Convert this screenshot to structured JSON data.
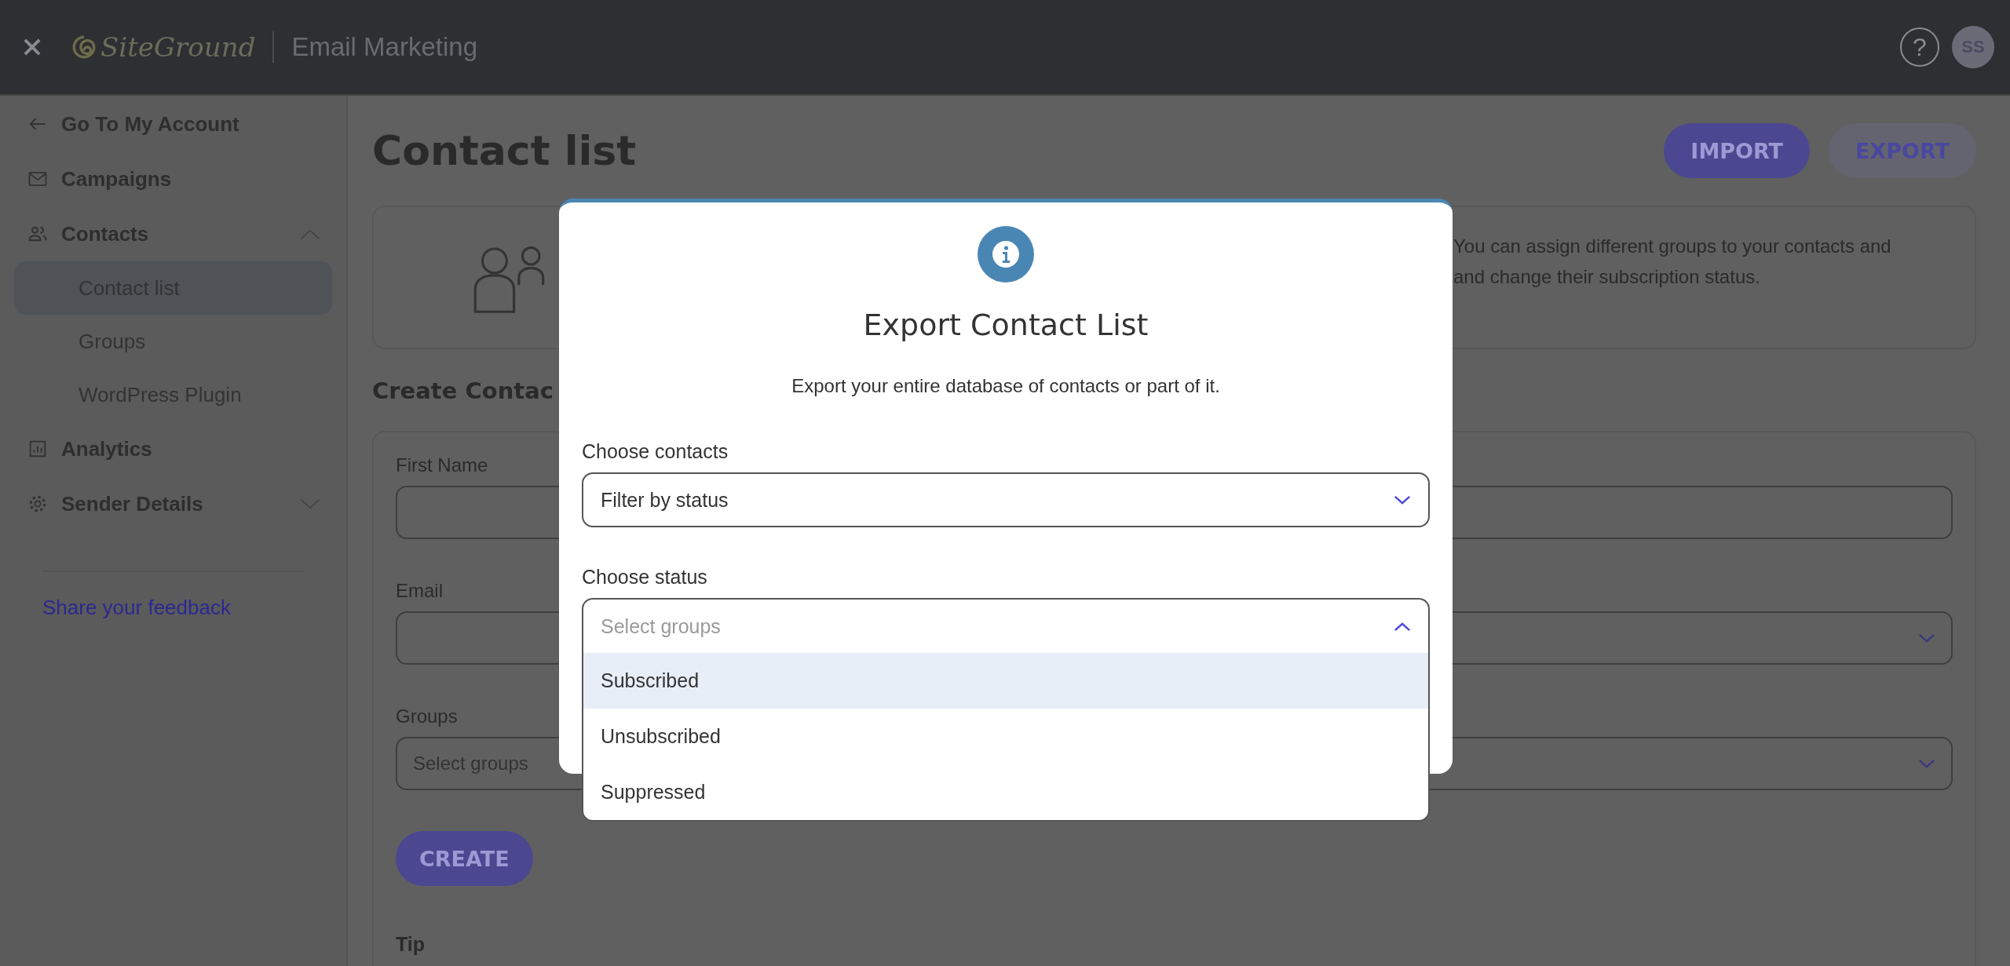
{
  "topbar": {
    "brand": "SiteGround",
    "product": "Email Marketing",
    "help": "?",
    "avatar": "SS"
  },
  "sidebar": {
    "back": "Go To My Account",
    "items": [
      {
        "label": "Campaigns"
      },
      {
        "label": "Contacts",
        "expanded": true,
        "children": [
          {
            "label": "Contact list",
            "selected": true
          },
          {
            "label": "Groups",
            "selected": false
          },
          {
            "label": "WordPress Plugin",
            "selected": false
          }
        ]
      },
      {
        "label": "Analytics"
      },
      {
        "label": "Sender Details",
        "expanded": false
      }
    ],
    "feedback": "Share your feedback"
  },
  "page": {
    "title": "Contact list",
    "buttons": [
      {
        "label": "IMPORT",
        "kind": "primary"
      },
      {
        "label": "EXPORT",
        "kind": "secondary"
      }
    ],
    "info_lines": [
      "You can assign different groups to your contacts and",
      "and change their subscription status."
    ],
    "section_heading": "Create Contac",
    "form_rows": [
      {
        "label": "First Name",
        "right_dropdown": false
      },
      {
        "label": "Email",
        "right_dropdown": true
      },
      {
        "label": "Groups",
        "placeholder": "Select groups",
        "right_dropdown": true
      }
    ],
    "create": "CREATE",
    "tip": "Tip"
  },
  "modal": {
    "title": "Export Contact List",
    "subtitle": "Export your entire database of contacts or part of it.",
    "fields": [
      {
        "label": "Choose contacts",
        "value": "Filter by status",
        "expanded": false
      },
      {
        "label": "Choose status",
        "placeholder": "Select groups",
        "expanded": true,
        "options": [
          {
            "label": "Subscribed",
            "selected": true
          },
          {
            "label": "Unsubscribed",
            "selected": false
          },
          {
            "label": "Suppressed",
            "selected": false
          }
        ]
      }
    ]
  }
}
